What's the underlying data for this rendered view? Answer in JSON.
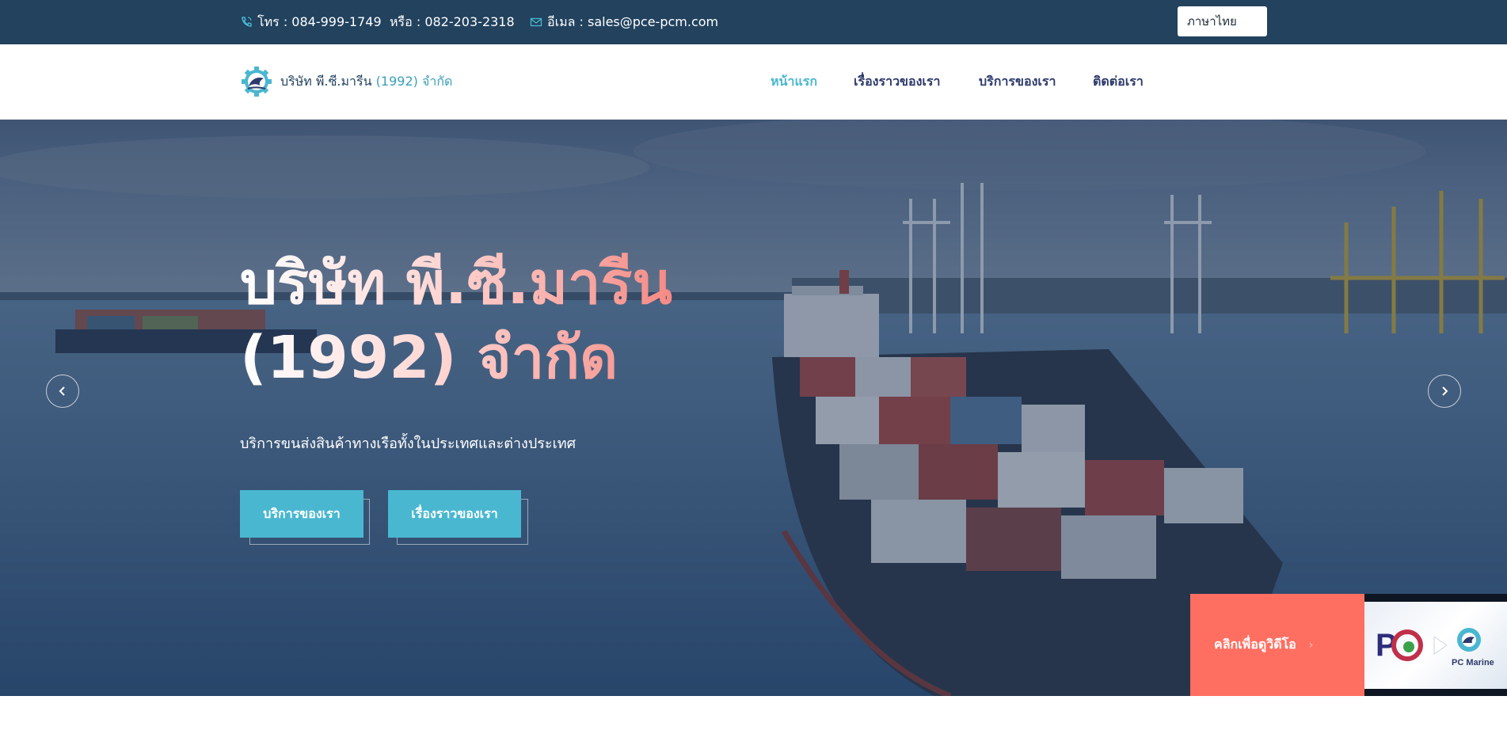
{
  "topbar": {
    "phone": "โทร : 084-999-1749",
    "phone_alt": "หรือ : 082-203-2318",
    "email": "อีเมล : sales@pce-pcm.com",
    "language": "ภาษาไทย"
  },
  "brand": {
    "name_prefix": "บริษัท พี.ซี.มารีน",
    "name_suffix": "(1992) จำกัด"
  },
  "nav": {
    "items": [
      {
        "label": "หน้าแรก"
      },
      {
        "label": "เรื่องราวของเรา"
      },
      {
        "label": "บริการของเรา"
      },
      {
        "label": "ติดต่อเรา"
      }
    ]
  },
  "hero": {
    "title_line1": "บริษัท พี.ซี.มารีน",
    "title_line2": "(1992) จำกัด",
    "subtitle": "บริการขนส่งสินค้าทางเรือทั้งในประเทศและต่างประเทศ",
    "button_services": "บริการของเรา",
    "button_story": "เรื่องราวของเรา"
  },
  "video": {
    "cta_label": "คลิกเพื่อดูวิดีโอ",
    "thumb_logo": "PC Marine"
  },
  "colors": {
    "topbar": "#22425e",
    "accent": "#4ab7d0",
    "nav_text": "#2d3a6b",
    "video_cta": "#ff6f61"
  }
}
